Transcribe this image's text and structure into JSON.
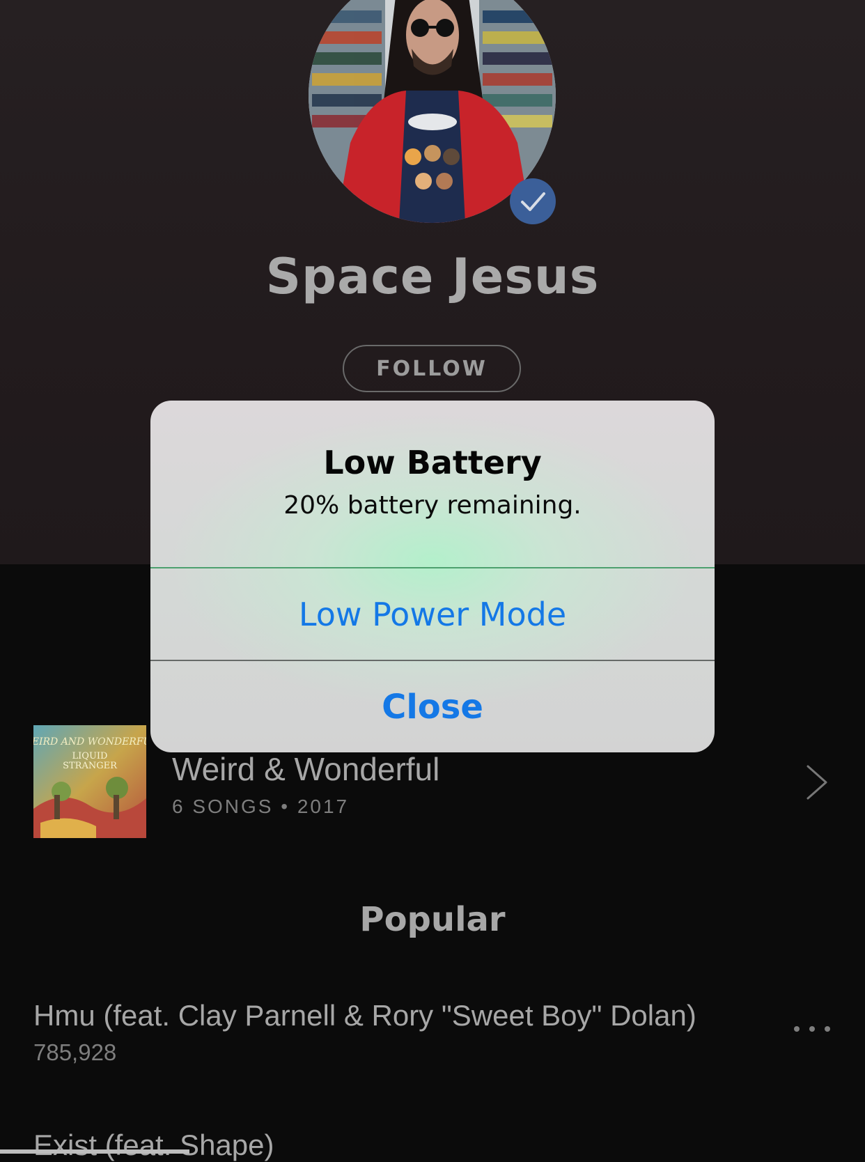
{
  "artist": {
    "name": "Space Jesus",
    "follow_label": "FOLLOW",
    "verified": true
  },
  "release": {
    "title": "Weird & Wonderful",
    "meta": "6 SONGS • 2017",
    "cover_text": "WEIRD AND WONDERFUL LIQUID STRANGER"
  },
  "popular": {
    "heading": "Popular",
    "tracks": [
      {
        "title": "Hmu (feat. Clay Parnell & Rory \"Sweet Boy\" Dolan)",
        "plays": "785,928"
      },
      {
        "title": "Exist (feat. Shape)",
        "plays": ""
      }
    ]
  },
  "alert": {
    "title": "Low Battery",
    "message": "20% battery remaining.",
    "primary_action": "Low Power Mode",
    "close_action": "Close"
  },
  "colors": {
    "alert_action": "#1478e6",
    "verified_badge": "#3b5f99",
    "background": "#0b0b0b"
  }
}
